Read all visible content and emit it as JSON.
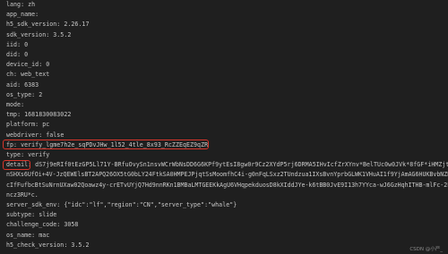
{
  "rows": [
    {
      "key": "lang",
      "value": "zh"
    },
    {
      "key": "app_name",
      "value": ""
    },
    {
      "key": "h5_sdk_version",
      "value": "2.26.17"
    },
    {
      "key": "sdk_version",
      "value": "3.5.2"
    },
    {
      "key": "iid",
      "value": "0"
    },
    {
      "key": "did",
      "value": "0"
    },
    {
      "key": "device_id",
      "value": "0"
    },
    {
      "key": "ch",
      "value": "web_text"
    },
    {
      "key": "aid",
      "value": "6383"
    },
    {
      "key": "os_type",
      "value": "2"
    },
    {
      "key": "mode",
      "value": ""
    },
    {
      "key": "tmp",
      "value": "1681830083022"
    },
    {
      "key": "platform",
      "value": "pc"
    },
    {
      "key": "webdriver",
      "value": "false"
    },
    {
      "key": "fp",
      "value": "verify_lgme7h2e_sqPDvJHw_1l52_4tle_8x93_RcZZEqEZ9qZR"
    },
    {
      "key": "type",
      "value": "verify"
    },
    {
      "key": "detail",
      "value": "dS7j9eRIf0tEzGP5Ll71Y-BRfuOvySn1nsvWCrWbNsDD6G6KPf9ytEsI8gw0r9Cz2XYdP5rj6DRMA5IHvIcfZrXYnv*BelTUc0w0JVk*8fGF*iHMZjt3m8"
    },
    {
      "key": "",
      "value": "nSHXs6UfOi+4V-JzQEWElsBT2APQ26OX5tG0bLY24FtkSA0HMPEJPjqtSsMoomfhC4i-g0nFqLSxz2TUndzua1IXsBvnYprbGLWK1VHuAI1f9YjAmAG6HUKBvbNZN"
    },
    {
      "key": "",
      "value": "cIfFufbcBtSuNrnUXaw02Qoawz4y-crETvUYjQ7Hd9nnRKn1BMBaLMTGEEKkAgU6VHqpekduosD8kXIddJYe-k6tBB0JvE9I13h7YYca-wJ6GzHqhITHB-mlFc-2Ej"
    },
    {
      "key": "",
      "value": "ncz3RU*c."
    },
    {
      "key": "server_sdk_env",
      "value": "{\"idc\":\"lf\",\"region\":\"CN\",\"server_type\":\"whale\"}"
    },
    {
      "key": "subtype",
      "value": "slide"
    },
    {
      "key": "challenge_code",
      "value": "3058"
    },
    {
      "key": "os_name",
      "value": "mac"
    },
    {
      "key": "h5_check_version",
      "value": "3.5.2"
    }
  ],
  "watermark": "CSDN @小严_"
}
